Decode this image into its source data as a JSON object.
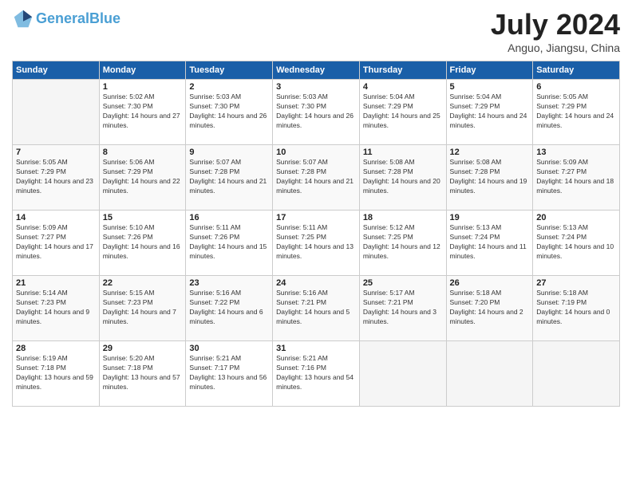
{
  "header": {
    "logo_line1": "General",
    "logo_line2": "Blue",
    "month": "July 2024",
    "location": "Anguo, Jiangsu, China"
  },
  "weekdays": [
    "Sunday",
    "Monday",
    "Tuesday",
    "Wednesday",
    "Thursday",
    "Friday",
    "Saturday"
  ],
  "weeks": [
    [
      {
        "day": "",
        "sunrise": "",
        "sunset": "",
        "daylight": ""
      },
      {
        "day": "1",
        "sunrise": "Sunrise: 5:02 AM",
        "sunset": "Sunset: 7:30 PM",
        "daylight": "Daylight: 14 hours and 27 minutes."
      },
      {
        "day": "2",
        "sunrise": "Sunrise: 5:03 AM",
        "sunset": "Sunset: 7:30 PM",
        "daylight": "Daylight: 14 hours and 26 minutes."
      },
      {
        "day": "3",
        "sunrise": "Sunrise: 5:03 AM",
        "sunset": "Sunset: 7:30 PM",
        "daylight": "Daylight: 14 hours and 26 minutes."
      },
      {
        "day": "4",
        "sunrise": "Sunrise: 5:04 AM",
        "sunset": "Sunset: 7:29 PM",
        "daylight": "Daylight: 14 hours and 25 minutes."
      },
      {
        "day": "5",
        "sunrise": "Sunrise: 5:04 AM",
        "sunset": "Sunset: 7:29 PM",
        "daylight": "Daylight: 14 hours and 24 minutes."
      },
      {
        "day": "6",
        "sunrise": "Sunrise: 5:05 AM",
        "sunset": "Sunset: 7:29 PM",
        "daylight": "Daylight: 14 hours and 24 minutes."
      }
    ],
    [
      {
        "day": "7",
        "sunrise": "Sunrise: 5:05 AM",
        "sunset": "Sunset: 7:29 PM",
        "daylight": "Daylight: 14 hours and 23 minutes."
      },
      {
        "day": "8",
        "sunrise": "Sunrise: 5:06 AM",
        "sunset": "Sunset: 7:29 PM",
        "daylight": "Daylight: 14 hours and 22 minutes."
      },
      {
        "day": "9",
        "sunrise": "Sunrise: 5:07 AM",
        "sunset": "Sunset: 7:28 PM",
        "daylight": "Daylight: 14 hours and 21 minutes."
      },
      {
        "day": "10",
        "sunrise": "Sunrise: 5:07 AM",
        "sunset": "Sunset: 7:28 PM",
        "daylight": "Daylight: 14 hours and 21 minutes."
      },
      {
        "day": "11",
        "sunrise": "Sunrise: 5:08 AM",
        "sunset": "Sunset: 7:28 PM",
        "daylight": "Daylight: 14 hours and 20 minutes."
      },
      {
        "day": "12",
        "sunrise": "Sunrise: 5:08 AM",
        "sunset": "Sunset: 7:28 PM",
        "daylight": "Daylight: 14 hours and 19 minutes."
      },
      {
        "day": "13",
        "sunrise": "Sunrise: 5:09 AM",
        "sunset": "Sunset: 7:27 PM",
        "daylight": "Daylight: 14 hours and 18 minutes."
      }
    ],
    [
      {
        "day": "14",
        "sunrise": "Sunrise: 5:09 AM",
        "sunset": "Sunset: 7:27 PM",
        "daylight": "Daylight: 14 hours and 17 minutes."
      },
      {
        "day": "15",
        "sunrise": "Sunrise: 5:10 AM",
        "sunset": "Sunset: 7:26 PM",
        "daylight": "Daylight: 14 hours and 16 minutes."
      },
      {
        "day": "16",
        "sunrise": "Sunrise: 5:11 AM",
        "sunset": "Sunset: 7:26 PM",
        "daylight": "Daylight: 14 hours and 15 minutes."
      },
      {
        "day": "17",
        "sunrise": "Sunrise: 5:11 AM",
        "sunset": "Sunset: 7:25 PM",
        "daylight": "Daylight: 14 hours and 13 minutes."
      },
      {
        "day": "18",
        "sunrise": "Sunrise: 5:12 AM",
        "sunset": "Sunset: 7:25 PM",
        "daylight": "Daylight: 14 hours and 12 minutes."
      },
      {
        "day": "19",
        "sunrise": "Sunrise: 5:13 AM",
        "sunset": "Sunset: 7:24 PM",
        "daylight": "Daylight: 14 hours and 11 minutes."
      },
      {
        "day": "20",
        "sunrise": "Sunrise: 5:13 AM",
        "sunset": "Sunset: 7:24 PM",
        "daylight": "Daylight: 14 hours and 10 minutes."
      }
    ],
    [
      {
        "day": "21",
        "sunrise": "Sunrise: 5:14 AM",
        "sunset": "Sunset: 7:23 PM",
        "daylight": "Daylight: 14 hours and 9 minutes."
      },
      {
        "day": "22",
        "sunrise": "Sunrise: 5:15 AM",
        "sunset": "Sunset: 7:23 PM",
        "daylight": "Daylight: 14 hours and 7 minutes."
      },
      {
        "day": "23",
        "sunrise": "Sunrise: 5:16 AM",
        "sunset": "Sunset: 7:22 PM",
        "daylight": "Daylight: 14 hours and 6 minutes."
      },
      {
        "day": "24",
        "sunrise": "Sunrise: 5:16 AM",
        "sunset": "Sunset: 7:21 PM",
        "daylight": "Daylight: 14 hours and 5 minutes."
      },
      {
        "day": "25",
        "sunrise": "Sunrise: 5:17 AM",
        "sunset": "Sunset: 7:21 PM",
        "daylight": "Daylight: 14 hours and 3 minutes."
      },
      {
        "day": "26",
        "sunrise": "Sunrise: 5:18 AM",
        "sunset": "Sunset: 7:20 PM",
        "daylight": "Daylight: 14 hours and 2 minutes."
      },
      {
        "day": "27",
        "sunrise": "Sunrise: 5:18 AM",
        "sunset": "Sunset: 7:19 PM",
        "daylight": "Daylight: 14 hours and 0 minutes."
      }
    ],
    [
      {
        "day": "28",
        "sunrise": "Sunrise: 5:19 AM",
        "sunset": "Sunset: 7:18 PM",
        "daylight": "Daylight: 13 hours and 59 minutes."
      },
      {
        "day": "29",
        "sunrise": "Sunrise: 5:20 AM",
        "sunset": "Sunset: 7:18 PM",
        "daylight": "Daylight: 13 hours and 57 minutes."
      },
      {
        "day": "30",
        "sunrise": "Sunrise: 5:21 AM",
        "sunset": "Sunset: 7:17 PM",
        "daylight": "Daylight: 13 hours and 56 minutes."
      },
      {
        "day": "31",
        "sunrise": "Sunrise: 5:21 AM",
        "sunset": "Sunset: 7:16 PM",
        "daylight": "Daylight: 13 hours and 54 minutes."
      },
      {
        "day": "",
        "sunrise": "",
        "sunset": "",
        "daylight": ""
      },
      {
        "day": "",
        "sunrise": "",
        "sunset": "",
        "daylight": ""
      },
      {
        "day": "",
        "sunrise": "",
        "sunset": "",
        "daylight": ""
      }
    ]
  ]
}
